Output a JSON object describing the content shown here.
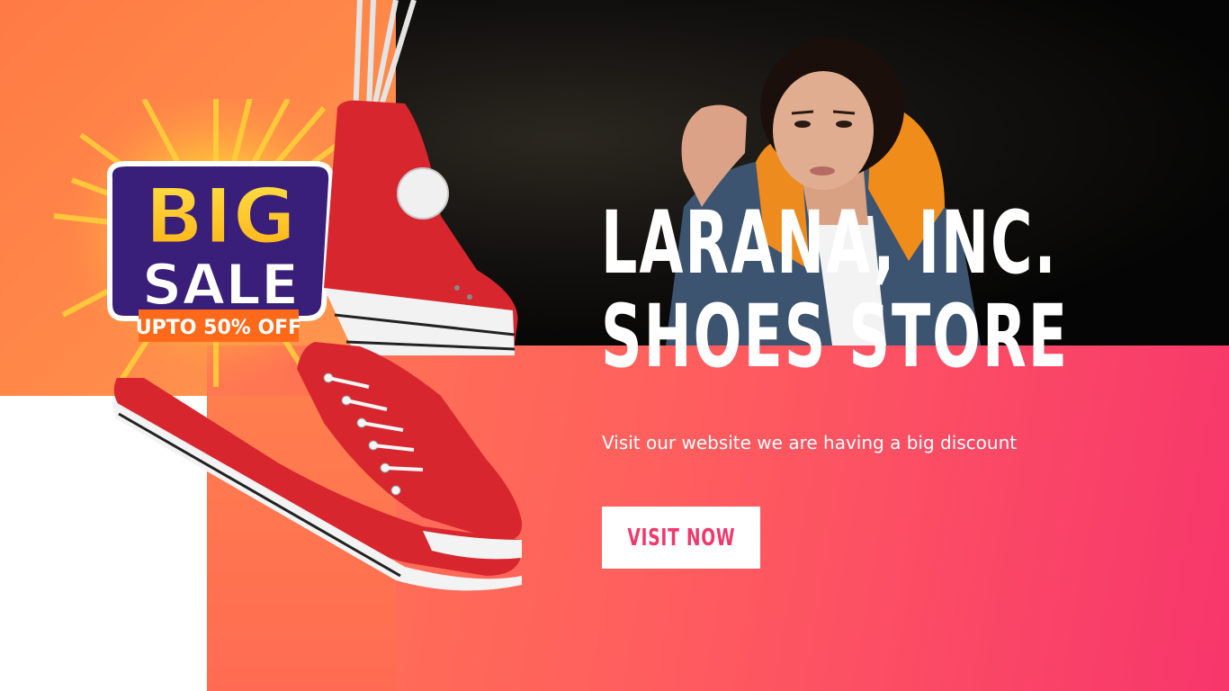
{
  "brand": {
    "title_line1": "LARANA, INC.",
    "title_line2": "SHOES STORE"
  },
  "subtitle": "Visit our website we are having a big discount",
  "cta": {
    "label": "VISIT NOW"
  },
  "badge": {
    "big": "BIG",
    "sale": "SALE",
    "offer": "UPTO 50% OFF"
  },
  "colors": {
    "orange": "#ff7a45",
    "pink": "#f7366c",
    "badge_yellow": "#ffc21a",
    "badge_purple": "#3a1f7a",
    "shoe_red": "#d8262f",
    "cta_text": "#f0386b"
  }
}
